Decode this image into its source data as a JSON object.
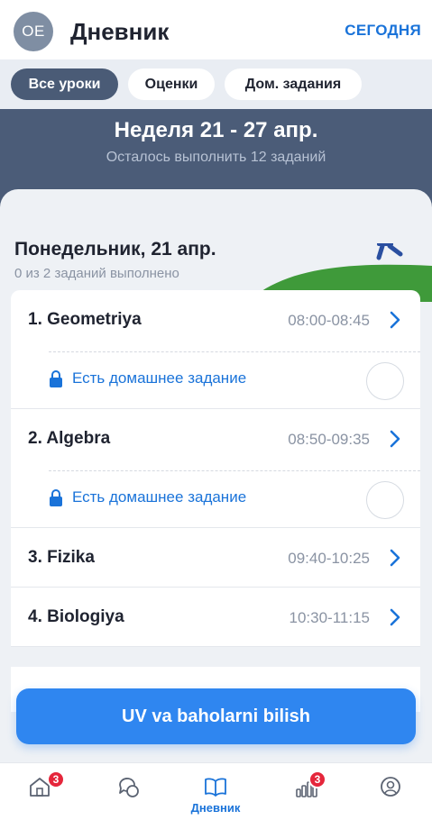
{
  "header": {
    "avatar_initials": "OE",
    "title": "Дневник",
    "today_button": "СЕГОДНЯ"
  },
  "filters": [
    {
      "label": "Все уроки",
      "active": true
    },
    {
      "label": "Оценки",
      "active": false
    },
    {
      "label": "Дом. задания",
      "active": false
    }
  ],
  "week": {
    "title": "Неделя 21 - 27 апр.",
    "subtitle": "Осталось выполнить 12 заданий"
  },
  "day": {
    "title": "Понедельник, 21 апр.",
    "progress_text": "0 из  2 заданий выполнено"
  },
  "lessons": [
    {
      "name": "1. Geometriya",
      "time": "08:00-08:45",
      "homework": "Есть домашнее задание"
    },
    {
      "name": "2. Algebra",
      "time": "08:50-09:35",
      "homework": "Есть домашнее задание"
    },
    {
      "name": "3. Fizika",
      "time": "09:40-10:25"
    },
    {
      "name": "4. Biologiya",
      "time": "10:30-11:15"
    }
  ],
  "cta_button": "UV va baholarni bilish",
  "bottom_nav": {
    "home_badge": "3",
    "diary_label": "Дневник",
    "stats_badge": "3"
  },
  "colors": {
    "accent": "#1a73d9",
    "header_band": "#4b5c78",
    "badge": "#e5263b",
    "cta": "#2f86f0"
  }
}
